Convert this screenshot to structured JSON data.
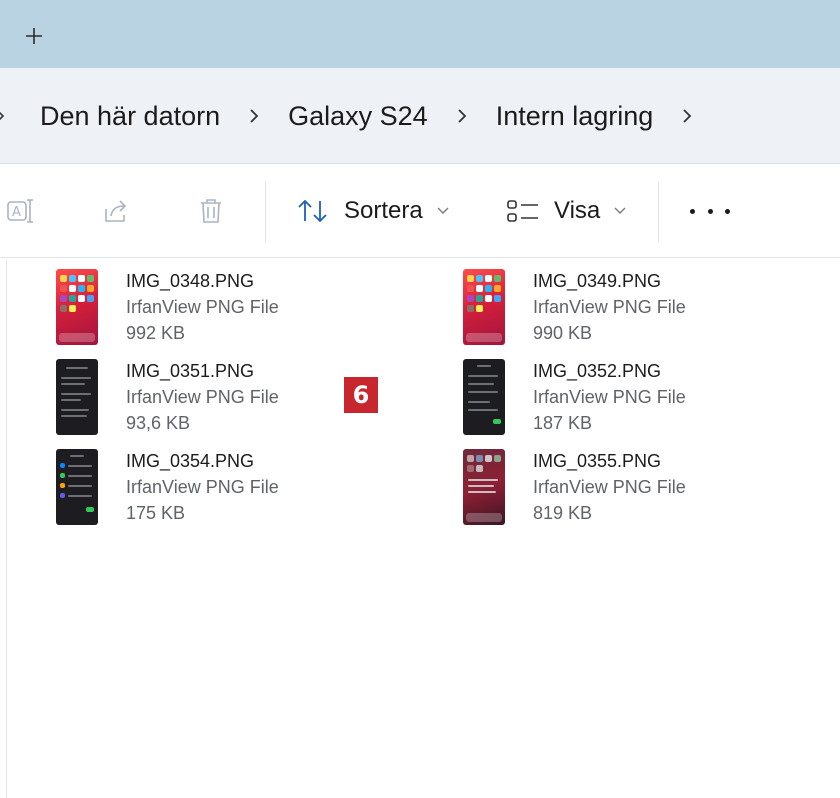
{
  "tabbar": {
    "new_tab_icon": "plus-icon",
    "background": "#b9d3e2"
  },
  "breadcrumb": {
    "items": [
      "Den här datorn",
      "Galaxy S24",
      "Intern lagring"
    ],
    "separator_icon": "chevron-right-icon"
  },
  "toolbar": {
    "icons": [
      "rename-icon",
      "share-icon",
      "delete-icon"
    ],
    "sort_label": "Sortera",
    "view_label": "Visa",
    "more_icon": "more-horizontal-icon"
  },
  "files": [
    {
      "name": "IMG_0348.PNG",
      "type": "IrfanView PNG File",
      "size": "992 KB",
      "thumb": "red"
    },
    {
      "name": "IMG_0349.PNG",
      "type": "IrfanView PNG File",
      "size": "990 KB",
      "thumb": "red"
    },
    {
      "name": "IMG_0351.PNG",
      "type": "IrfanView PNG File",
      "size": "93,6 KB",
      "thumb": "dark"
    },
    {
      "name": "IMG_0352.PNG",
      "type": "IrfanView PNG File",
      "size": "187 KB",
      "thumb": "dark"
    },
    {
      "name": "IMG_0354.PNG",
      "type": "IrfanView PNG File",
      "size": "175 KB",
      "thumb": "dark"
    },
    {
      "name": "IMG_0355.PNG",
      "type": "IrfanView PNG File",
      "size": "819 KB",
      "thumb": "darkred"
    }
  ],
  "badge": {
    "number": "6",
    "color": "#c8262e"
  }
}
